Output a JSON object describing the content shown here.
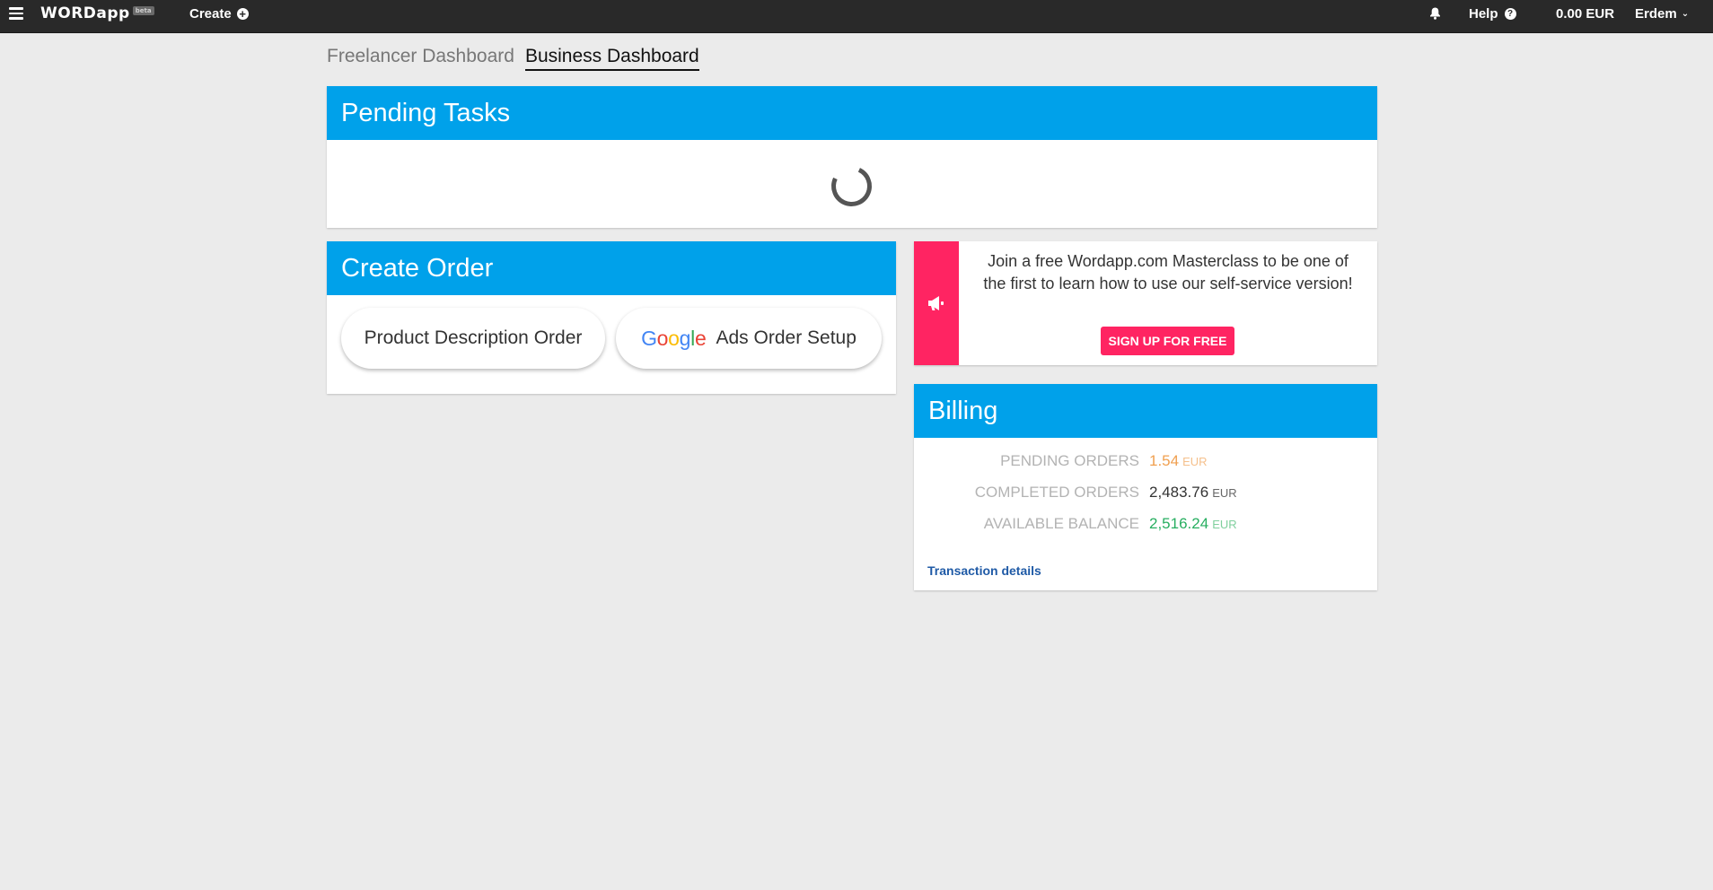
{
  "navbar": {
    "logo": "WORDapp",
    "logo_badge": "beta",
    "create_label": "Create",
    "help_label": "Help",
    "balance": "0.00 EUR",
    "user_name": "Erdem"
  },
  "tabs": [
    {
      "label": "Freelancer Dashboard",
      "active": false
    },
    {
      "label": "Business Dashboard",
      "active": true
    }
  ],
  "pending_tasks": {
    "title": "Pending Tasks"
  },
  "create_order": {
    "title": "Create Order",
    "product_button": "Product Description Order",
    "google_brand": "Google",
    "google_button": "Ads Order Setup"
  },
  "promo": {
    "text": "Join a free Wordapp.com Masterclass to be one of the first to learn how to use our self-service version!",
    "button": "SIGN UP FOR FREE"
  },
  "billing": {
    "title": "Billing",
    "rows": [
      {
        "label": "PENDING ORDERS",
        "value": "1.54",
        "currency": "EUR"
      },
      {
        "label": "COMPLETED ORDERS",
        "value": "2,483.76",
        "currency": "EUR"
      },
      {
        "label": "AVAILABLE BALANCE",
        "value": "2,516.24",
        "currency": "EUR"
      }
    ],
    "link": "Transaction details"
  },
  "colors": {
    "navbar_bg": "#292929",
    "panel_header": "#00a1ea",
    "promo_accent": "#ff2462",
    "pending_value": "#f0a050",
    "balance_value": "#27ae60",
    "link": "#1f5aa6"
  }
}
